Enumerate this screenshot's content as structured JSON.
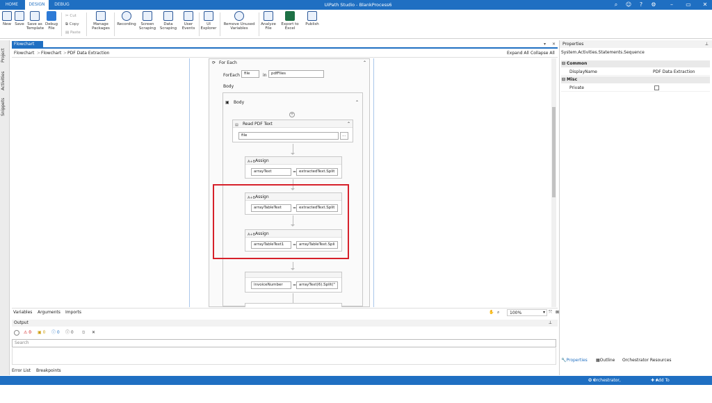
{
  "app": {
    "title": "UiPath Studio - BlankProcess6"
  },
  "top_tabs": [
    "HOME",
    "DESIGN",
    "DEBUG"
  ],
  "ribbon": {
    "new": "New",
    "save": "Save",
    "save_as_template": "Save as Template",
    "debug_file": "Debug File",
    "cut": "Cut",
    "copy": "Copy",
    "paste": "Paste",
    "manage_packages": "Manage Packages",
    "recording": "Recording",
    "screen_scraping": "Screen Scraping",
    "data_scraping": "Data Scraping",
    "user_events": "User Events",
    "ui_explorer": "UI Explorer",
    "remove_unused_variables": "Remove Unused Variables",
    "analyze_file": "Analyze File",
    "export_to_excel": "Export to Excel",
    "publish": "Publish"
  },
  "sidebar": [
    "Project",
    "Activities",
    "Snippets"
  ],
  "document": {
    "tab": "Flowchart",
    "breadcrumb": [
      "Flowchart",
      "Flowchart",
      "PDF Data Extraction"
    ],
    "expand_all": "Expand All",
    "collapse_all": "Collapse All"
  },
  "workflow": {
    "foreach_title": "For Each",
    "foreach_label": "ForEach",
    "foreach_item": "file",
    "in_label": "in",
    "foreach_collection": "pdfFiles",
    "body_label": "Body",
    "body_seq_title": "Body",
    "read_pdf": {
      "title": "Read PDF Text",
      "value": "file",
      "browse": "..."
    },
    "assigns": [
      {
        "title": "Assign",
        "to": "arrayText",
        "value": "extractedText.Split"
      },
      {
        "title": "Assign",
        "to": "arrayTableText",
        "value": "extractedText.Split"
      },
      {
        "title": "Assign",
        "to": "arrayTableText1",
        "value": "arrayTableText.Spli"
      },
      {
        "title": "",
        "to": "invoiceNumber",
        "value": "arrayText(6).Split(\""
      }
    ],
    "eq": "="
  },
  "bottom_tabs": {
    "variables": "Variables",
    "arguments": "Arguments",
    "imports": "Imports",
    "zoom": "100%"
  },
  "output": {
    "title": "Output",
    "filters": [
      {
        "count": "0"
      },
      {
        "count": "0"
      },
      {
        "count": "0"
      },
      {
        "count": "0"
      }
    ],
    "search_placeholder": "Search"
  },
  "error_tabs": {
    "error_list": "Error List",
    "breakpoints": "Breakpoints"
  },
  "properties": {
    "title": "Properties",
    "type": "System.Activities.Statements.Sequence",
    "common": "Common",
    "display_name_key": "DisplayName",
    "display_name_value": "PDF Data Extraction",
    "misc": "Misc",
    "private_key": "Private",
    "tabs": {
      "properties": "Properties",
      "outline": "Outline",
      "orchestrator": "Orchestrator Resources"
    }
  },
  "status": {
    "orchestrator": "Orchestrator, Default",
    "source_control": "Add To Source Control"
  },
  "colors": {
    "accent": "#1f6fc2",
    "highlight": "#d6202a"
  }
}
